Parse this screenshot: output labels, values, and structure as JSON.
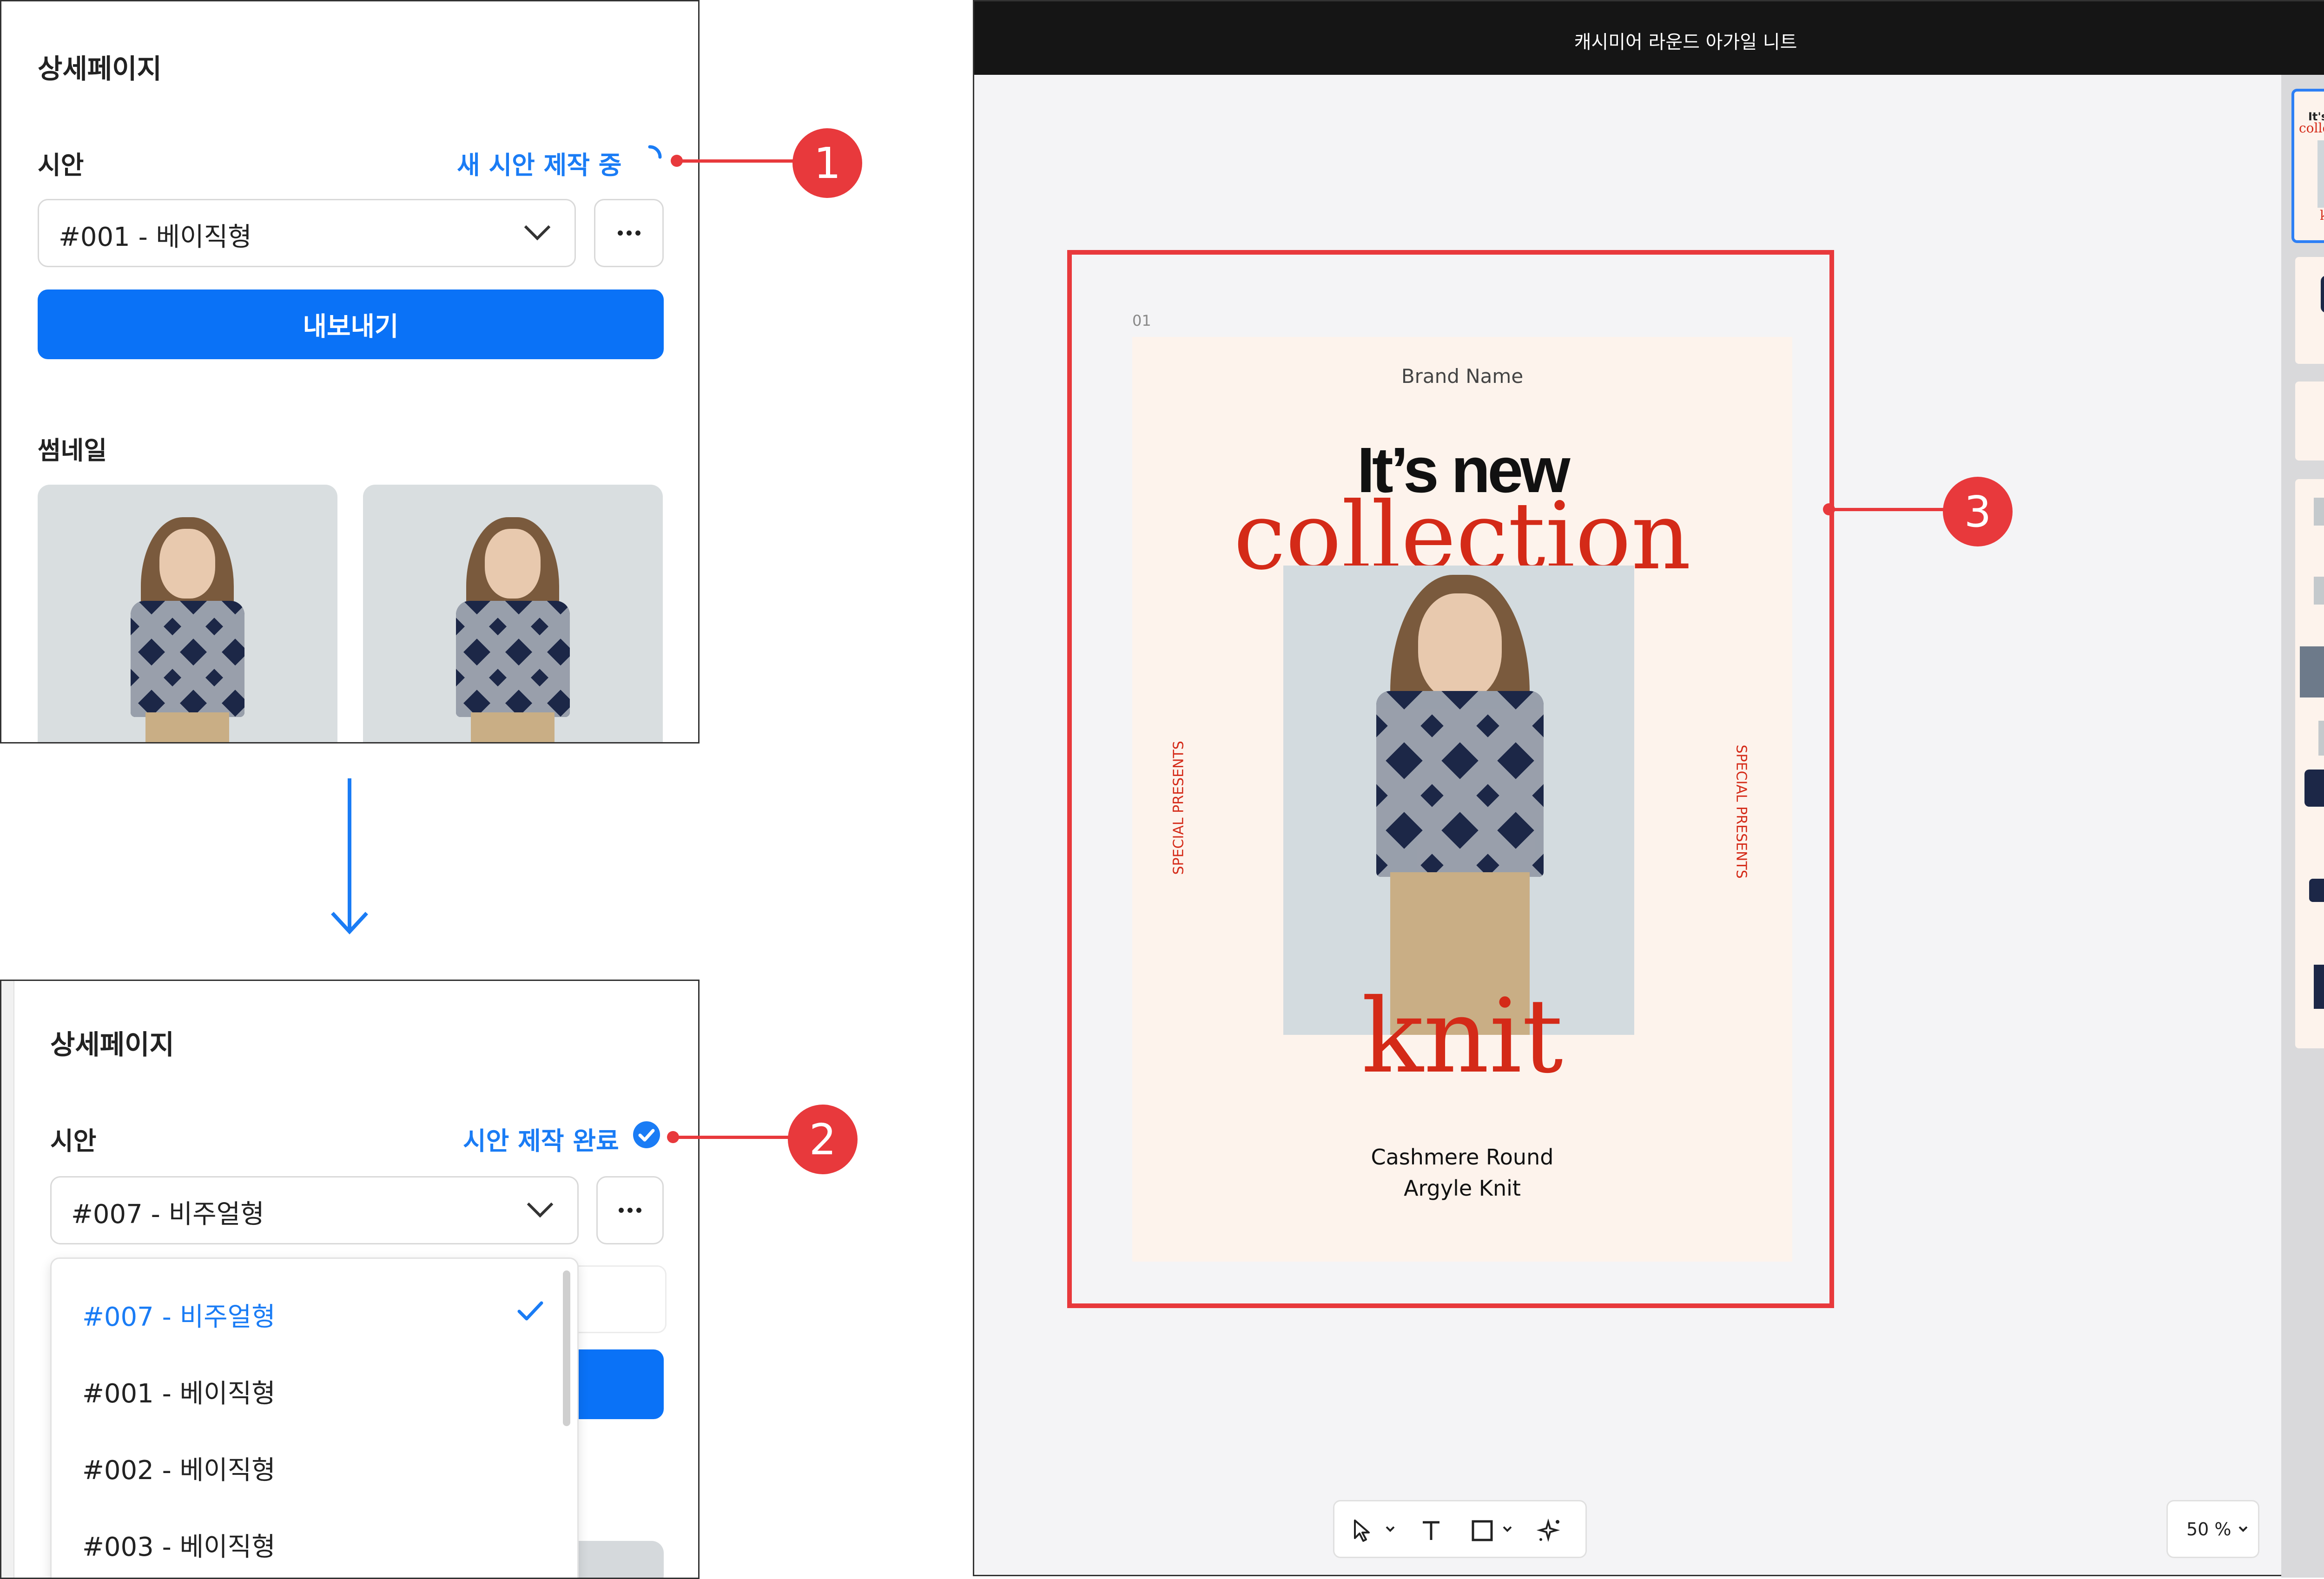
{
  "panel_top": {
    "title": "상세페이지",
    "draft_label": "시안",
    "status": "새 시안 제작 중",
    "selected": "#001 - 베이직형",
    "export_label": "내보내기",
    "thumbnail_label": "썸네일"
  },
  "panel_bottom": {
    "title": "상세페이지",
    "draft_label": "시안",
    "status": "시안 제작 완료",
    "selected": "#007 - 비주얼형",
    "options": [
      "#007 - 비주얼형",
      "#001 - 베이직형",
      "#002 - 베이직형",
      "#003 - 베이직형"
    ]
  },
  "callouts": [
    "1",
    "2",
    "3"
  ],
  "editor": {
    "window_title": "캐시미어 라운드 아가일 니트",
    "page_number": "01",
    "zoom": "50 %",
    "toolbar_icons": [
      "pointer-icon",
      "text-icon",
      "rectangle-icon",
      "sparkle-icon"
    ]
  },
  "poster": {
    "brand": "Brand Name",
    "headline": "It’s new",
    "script_top": "collection",
    "script_bottom": "knit",
    "side_left": "SPECIAL PRESENTS",
    "side_right": "SPECIAL PRESENTS",
    "product_line1": "Cashmere Round",
    "product_line2": "Argyle Knit"
  },
  "colors": {
    "accent_blue": "#1a7cf5",
    "button_blue": "#0a72f7",
    "callout_red": "#e8393c",
    "poster_red": "#d42a18",
    "poster_bg": "#fdf3ec"
  }
}
